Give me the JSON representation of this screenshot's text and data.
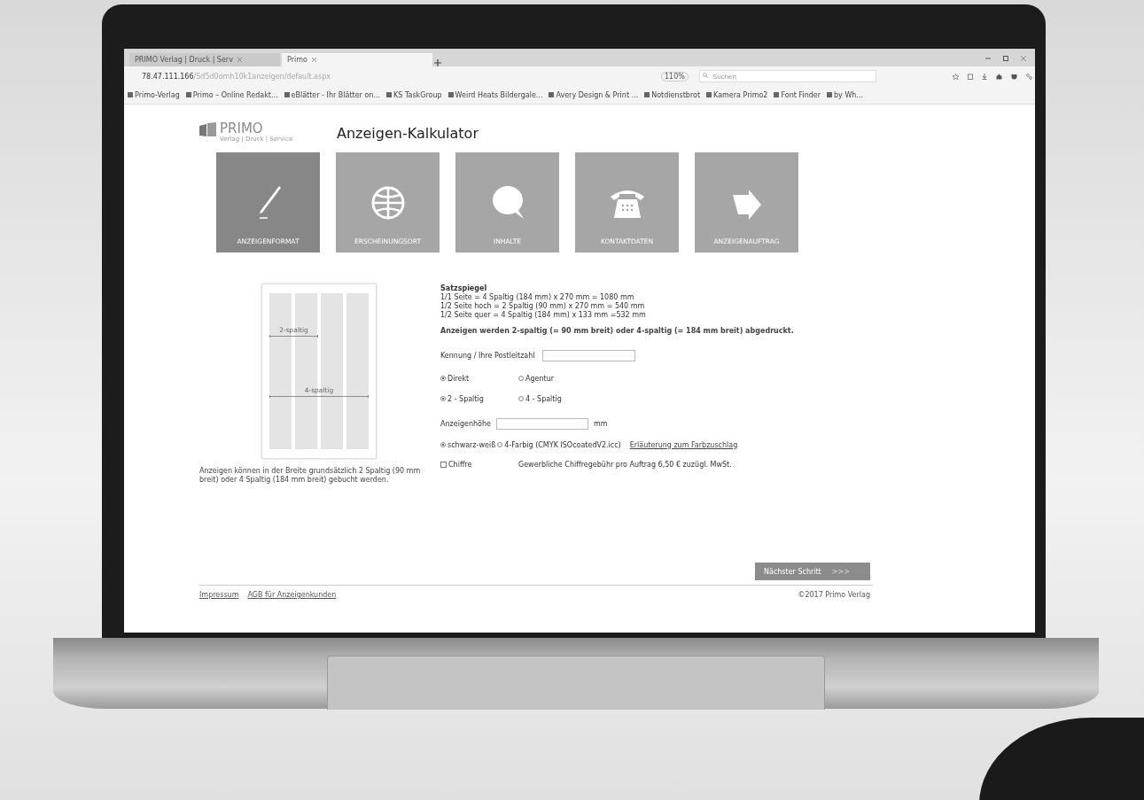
{
  "browser": {
    "tabs": [
      {
        "label": "PRIMO Verlag | Druck | Serv",
        "selected": false
      },
      {
        "label": "Primo",
        "selected": true
      }
    ],
    "url_host": "78.47.111.166",
    "url_path": "/Sd5d0omh10k1anzeigen/default.aspx",
    "zoom": "110%",
    "search": {
      "placeholder": "Suchen"
    },
    "bookmarks": [
      "Primo-Verlag",
      "Primo – Online Redakt...",
      "eBlätter - Ihr Blätter on...",
      "KS TaskGroup",
      "Weird Heats Bildergale...",
      "Avery Design & Print ...",
      "Notdienstbrot",
      "Kamera Primo2",
      "Font Finder",
      "by Wh..."
    ]
  },
  "page": {
    "logo": {
      "name": "PRIMO",
      "tagline": "Verlag | Druck | Service"
    },
    "title": "Anzeigen-Kalkulator",
    "steps": [
      {
        "label": "ANZEIGENFORMAT",
        "kind": "pen",
        "selected": true
      },
      {
        "label": "ERSCHEINUNGSORT",
        "kind": "globe",
        "selected": false
      },
      {
        "label": "INHALTE",
        "kind": "bubble",
        "selected": false
      },
      {
        "label": "KONTAKTDATEN",
        "kind": "phone",
        "selected": false
      },
      {
        "label": "ANZEIGENAUFTRAG",
        "kind": "arrow",
        "selected": false
      }
    ],
    "diagram": {
      "label_narrow": "2-spaltig",
      "label_wide": "4-spaltig"
    },
    "caption": "Anzeigen können in der Breite grundsätzlich 2 Spaltig (90 mm breit) oder 4 Spaltig (184 mm breit) gebucht werden.",
    "satzspiegel": {
      "heading": "Satzspiegel",
      "lines": [
        "1/1 Seite = 4 Spaltig (184 mm) x 270 mm = 1080 mm",
        "1/2 Seite hoch = 2 Spaltig (90 mm) x 270 mm = 540 mm",
        "1/2 Seite quer = 4 Spaltig (184 mm) x 133 mm =532 mm"
      ]
    },
    "note": "Anzeigen werden 2-spaltig (= 90 mm breit) oder 4-spaltig (= 184 mm breit) abgedruckt.",
    "id_field": {
      "label": "Kennung / Ihre Postleitzahl"
    },
    "radio_groups": [
      [
        {
          "label": "Direkt",
          "selected": true
        },
        {
          "label": "Agentur",
          "selected": false
        }
      ],
      [
        {
          "label": "2 - Spaltig",
          "selected": true
        },
        {
          "label": "4 - Spaltig",
          "selected": false
        }
      ]
    ],
    "height_field": {
      "label": "Anzeigenhöhe",
      "unit": "mm"
    },
    "color_options": [
      {
        "label": "schwarz-weiß",
        "selected": true
      },
      {
        "label": "4-Farbig (CMYK ISOcoatedV2.icc)",
        "selected": false
      }
    ],
    "color_link": "Erläuterung zum Farbzuschlag",
    "chiffre": {
      "label": "Chiffre",
      "checked": false,
      "note": "Gewerbliche Chiffregebühr pro Auftrag 6,50 € zuzügl. MwSt."
    },
    "next_button": {
      "label": "Nächster Schritt",
      "arrows": ">>>"
    },
    "footer_links": [
      "Impressum",
      "AGB für Anzeigenkunden"
    ],
    "copyright": "©2017 Primo Verlag"
  }
}
